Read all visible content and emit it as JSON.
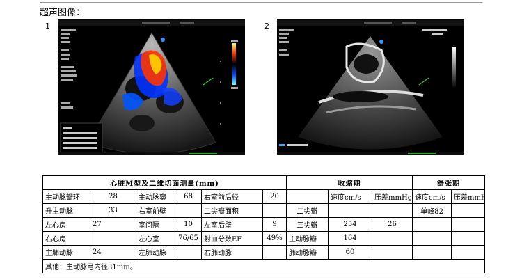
{
  "section_title": "超声图像：",
  "images": [
    {
      "number": "1"
    },
    {
      "number": "2"
    }
  ],
  "table": {
    "header": {
      "morphology": "心脏M型及二维切面测量(mm)",
      "systolic": "收缩期",
      "diastolic": "舒张期"
    },
    "rows": [
      {
        "c1": "主动脉瓣环",
        "c2": "28",
        "c3": "主动脉窦",
        "c4": "68",
        "c5": "右室前后径",
        "c6": "20",
        "c7": "",
        "c8": "速度cm/s",
        "c9": "压差mmHg",
        "c10": "速度cm/s",
        "c11": "压差mmHg"
      },
      {
        "c1": "升主动脉",
        "c2": "33",
        "c3": "右室前壁",
        "c4": "",
        "c5": "二尖瓣面积",
        "c6": "",
        "c7": "二尖瓣",
        "c8": "",
        "c9": "",
        "c10": "单峰82",
        "c11": ""
      },
      {
        "c1": "左心房",
        "c2": "27",
        "c3": "室间隔",
        "c4": "10",
        "c5": "左室后壁",
        "c6": "9",
        "c7": "三尖瓣",
        "c8": "254",
        "c9": "26",
        "c10": "",
        "c11": ""
      },
      {
        "c1": "右心房",
        "c2": "",
        "c3": "左心室",
        "c4": "76/65",
        "c5": "射血分数EF",
        "c6": "49%",
        "c7": "主动脉瓣",
        "c8": "164",
        "c9": "",
        "c10": "",
        "c11": ""
      },
      {
        "c1": "主肺动脉",
        "c2": "24",
        "c3": "左肺动脉",
        "c4": "",
        "c5": "右肺动脉",
        "c6": "",
        "c7": "肺动脉瓣",
        "c8": "60",
        "c9": "",
        "c10": "",
        "c11": ""
      }
    ],
    "other": "其他：主动脉弓内径31mm。"
  },
  "colors": {
    "ultrasound_bg": "#000000",
    "border": "#000000"
  }
}
